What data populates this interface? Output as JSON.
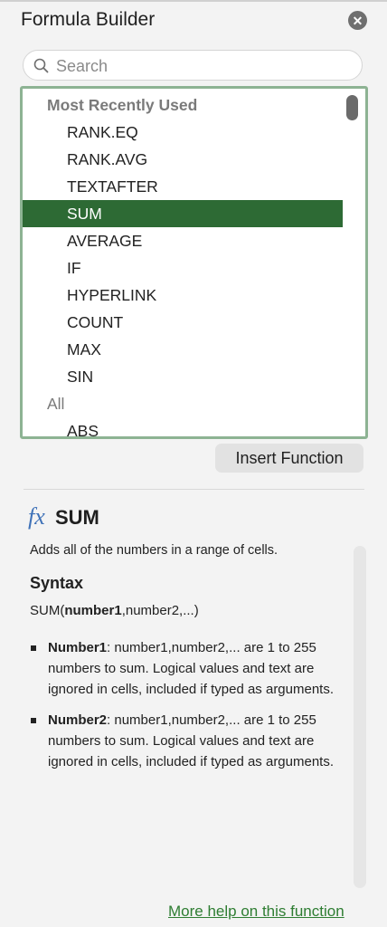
{
  "panel": {
    "title": "Formula Builder",
    "close_icon": "close-icon"
  },
  "search": {
    "placeholder": "Search",
    "value": ""
  },
  "list": {
    "groups": [
      {
        "label": "Most Recently Used",
        "items": [
          "RANK.EQ",
          "RANK.AVG",
          "TEXTAFTER",
          "SUM",
          "AVERAGE",
          "IF",
          "HYPERLINK",
          "COUNT",
          "MAX",
          "SIN"
        ]
      },
      {
        "label": "All",
        "items": [
          "ABS"
        ]
      }
    ],
    "selected": "SUM"
  },
  "insert_button": "Insert Function",
  "detail": {
    "icon_text": "fx",
    "name": "SUM",
    "description": "Adds all of the numbers in a range of cells.",
    "syntax_heading": "Syntax",
    "syntax_prefix": "SUM(",
    "syntax_bold": "number1",
    "syntax_suffix": ",number2,...)",
    "args": [
      {
        "name": "Number1",
        "text": ": number1,number2,... are 1 to 255 numbers to sum. Logical values and text are ignored in cells, included if typed as arguments."
      },
      {
        "name": "Number2",
        "text": ": number1,number2,... are 1 to 255 numbers to sum. Logical values and text are ignored in cells, included if typed as arguments."
      }
    ]
  },
  "more_help": "More help on this function",
  "colors": {
    "accent": "#2d6a34",
    "list_border": "#8db393",
    "link": "#2e7d32",
    "fx": "#3f72b8"
  }
}
